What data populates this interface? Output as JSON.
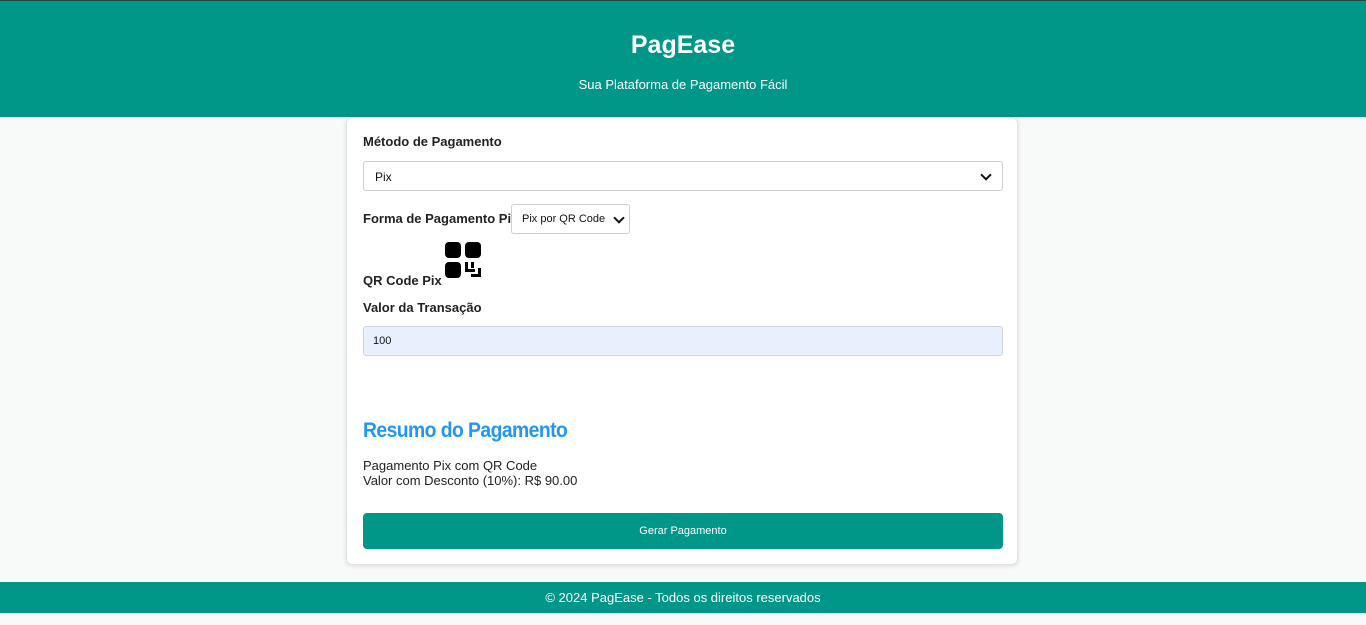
{
  "header": {
    "title": "PagEase",
    "subtitle": "Sua Plataforma de Pagamento Fácil"
  },
  "form": {
    "payment_method_label": "Método de Pagamento",
    "payment_method_value": "Pix",
    "pix_type_label": "Forma de Pagamento Pix",
    "pix_type_value": "Pix por QR Code",
    "qr_label": "QR Code Pix",
    "qr_icon": "qr-code-icon",
    "amount_label": "Valor da Transação",
    "amount_value": "100"
  },
  "summary": {
    "title": "Resumo do Pagamento",
    "line1": "Pagamento Pix com QR Code",
    "line2": "Valor com Desconto (10%): R$ 90.00"
  },
  "actions": {
    "generate_label": "Gerar Pagamento"
  },
  "footer": {
    "text": "© 2024 PagEase - Todos os direitos reservados"
  },
  "colors": {
    "brand": "#009688",
    "summary_title": "#2196f3",
    "input_bg": "#e8f0fe"
  }
}
